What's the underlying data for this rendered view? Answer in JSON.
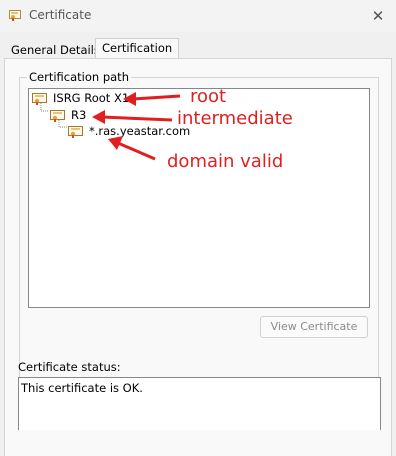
{
  "window": {
    "title": "Certificate"
  },
  "tabs": [
    {
      "label": "General"
    },
    {
      "label": "Details"
    },
    {
      "label": "Certification Path"
    }
  ],
  "certification_path": {
    "group_label": "Certification path",
    "nodes": [
      {
        "label": "ISRG Root X1"
      },
      {
        "label": "R3"
      },
      {
        "label": "*.ras.yeastar.com"
      }
    ]
  },
  "annotations": [
    {
      "text": "root",
      "color": "#e02020"
    },
    {
      "text": "intermediate",
      "color": "#e02020"
    },
    {
      "text": "domain valid",
      "color": "#e02020"
    }
  ],
  "view_certificate_button": {
    "label": "View Certificate"
  },
  "certificate_status": {
    "label": "Certificate status:",
    "text": "This certificate is OK."
  }
}
